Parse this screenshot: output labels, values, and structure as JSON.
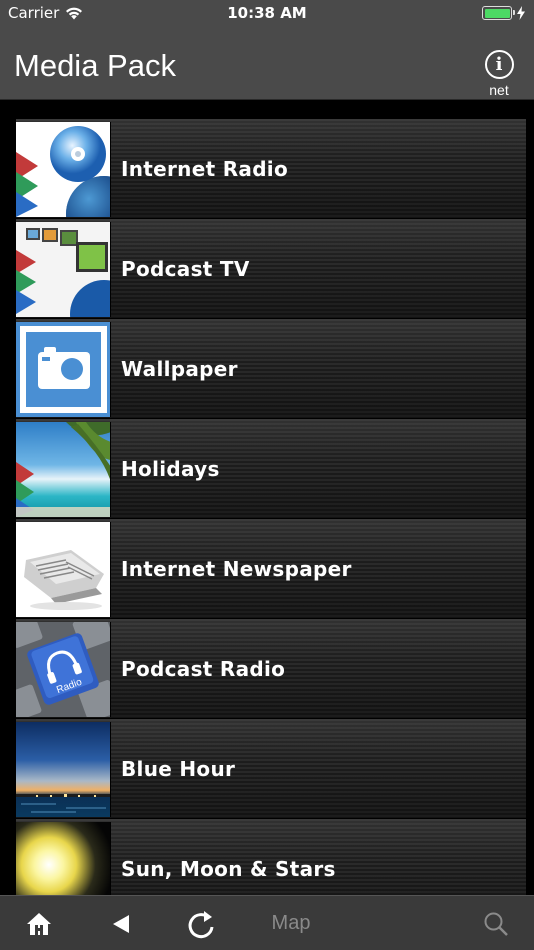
{
  "status_bar": {
    "carrier": "Carrier",
    "time": "10:38 AM",
    "battery_level": 1.0
  },
  "header": {
    "title": "Media Pack",
    "info_label": "net"
  },
  "list": {
    "items": [
      {
        "label": "Internet Radio",
        "icon": "internet-radio-icon"
      },
      {
        "label": "Podcast TV",
        "icon": "podcast-tv-icon"
      },
      {
        "label": "Wallpaper",
        "icon": "camera-icon"
      },
      {
        "label": "Holidays",
        "icon": "beach-icon"
      },
      {
        "label": "Internet Newspaper",
        "icon": "newspaper-icon"
      },
      {
        "label": "Podcast Radio",
        "icon": "headphones-key-icon",
        "thumb_text": "Radio"
      },
      {
        "label": "Blue Hour",
        "icon": "blue-hour-icon"
      },
      {
        "label": "Sun, Moon & Stars",
        "icon": "sun-icon"
      }
    ]
  },
  "tab_bar": {
    "home_icon": "home-icon",
    "back_icon": "back-icon",
    "reload_icon": "reload-icon",
    "map_label": "Map",
    "search_icon": "search-icon"
  },
  "colors": {
    "header_bg": "#4a4a4a",
    "battery": "#4cd964",
    "tab_bar_bg": "#3a3a3a",
    "disabled_text": "#8a8a8a"
  }
}
